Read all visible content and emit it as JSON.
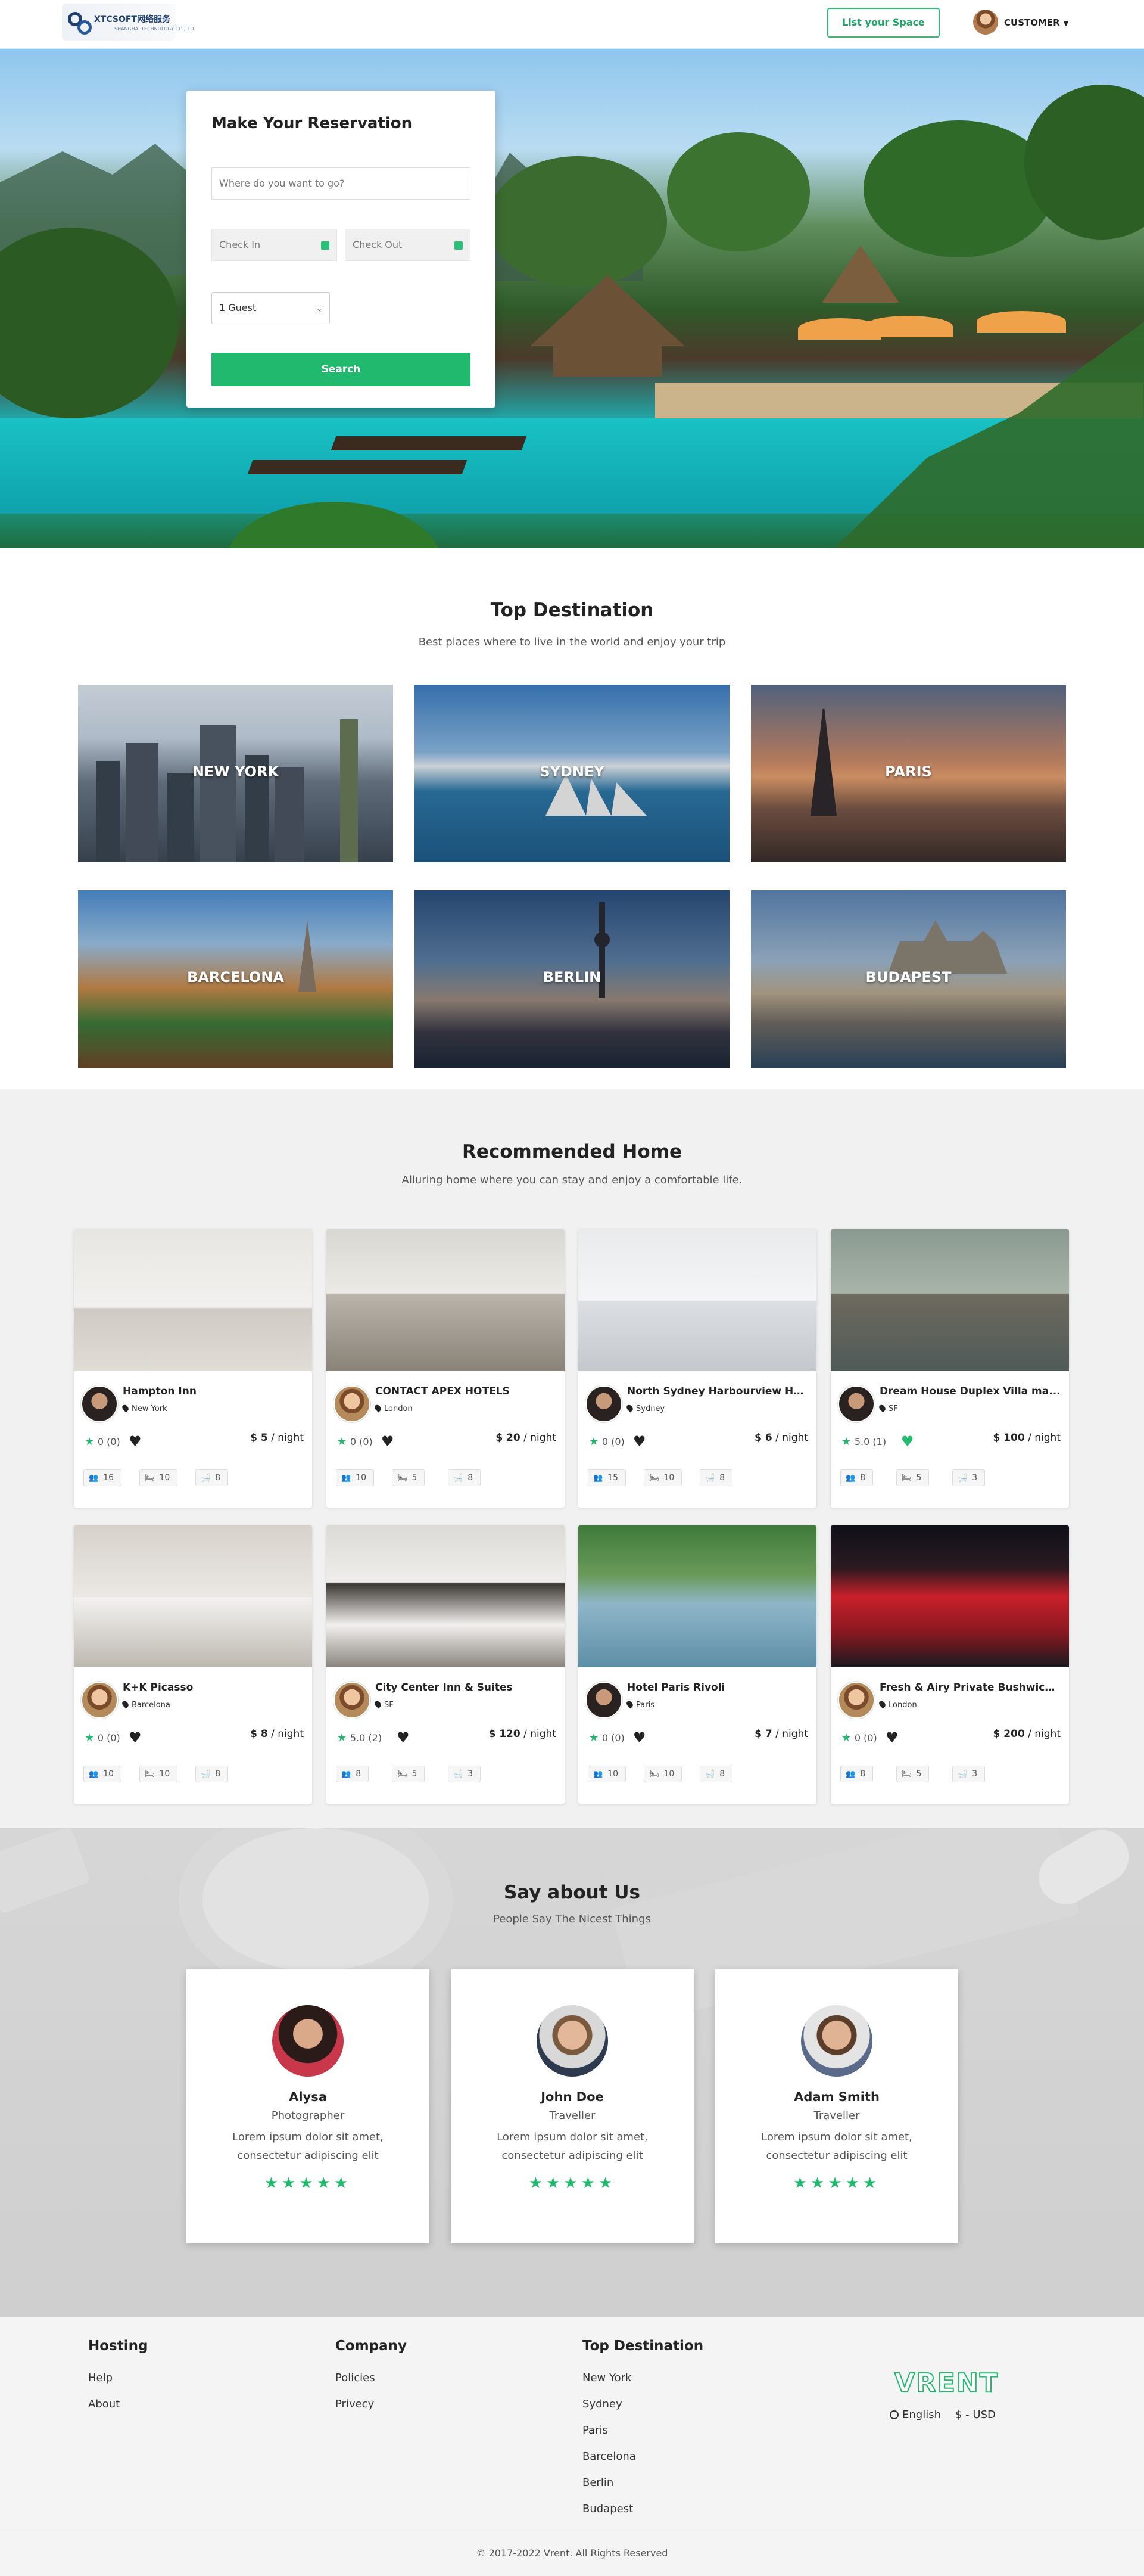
{
  "header": {
    "logo_text": "XTCSOFT网络服务",
    "logo_sub": "SHANGHAI TECHNOLOGY CO.,LTD",
    "list_space": "List your Space",
    "user_label": "CUSTOMER"
  },
  "reservation": {
    "title": "Make Your Reservation",
    "where_placeholder": "Where do you want to go?",
    "checkin_placeholder": "Check In",
    "checkout_placeholder": "Check Out",
    "guest_value": "1 Guest",
    "search_label": "Search"
  },
  "top_destination": {
    "title": "Top Destination",
    "subtitle": "Best places where to live in the world and enjoy your trip",
    "items": [
      {
        "label": "NEW YORK"
      },
      {
        "label": "SYDNEY"
      },
      {
        "label": "PARIS"
      },
      {
        "label": "BARCELONA"
      },
      {
        "label": "BERLIN"
      },
      {
        "label": "BUDAPEST"
      }
    ]
  },
  "recommended": {
    "title": "Recommended Home",
    "subtitle": "Alluring home where you can stay and enjoy a comfortable life.",
    "per_night": "/ night",
    "homes": [
      {
        "name": "Hampton Inn",
        "location": "New York",
        "rating": "0 (0)",
        "price": "$ 5",
        "guests": "16",
        "beds": "10",
        "baths": "8",
        "liked": false
      },
      {
        "name": "CONTACT APEX HOTELS",
        "location": "London",
        "rating": "0 (0)",
        "price": "$ 20",
        "guests": "10",
        "beds": "5",
        "baths": "8",
        "liked": false
      },
      {
        "name": "North Sydney Harbourview Ho...",
        "location": "Sydney",
        "rating": "0 (0)",
        "price": "$ 6",
        "guests": "15",
        "beds": "10",
        "baths": "8",
        "liked": false
      },
      {
        "name": "Dream House Duplex Villa ma...",
        "location": "SF",
        "rating": "5.0 (1)",
        "price": "$ 100",
        "guests": "8",
        "beds": "5",
        "baths": "3",
        "liked": true
      },
      {
        "name": "K+K Picasso",
        "location": "Barcelona",
        "rating": "0 (0)",
        "price": "$ 8",
        "guests": "10",
        "beds": "10",
        "baths": "8",
        "liked": false
      },
      {
        "name": "City Center Inn & Suites",
        "location": "SF",
        "rating": "5.0 (2)",
        "price": "$ 120",
        "guests": "8",
        "beds": "5",
        "baths": "3",
        "liked": false
      },
      {
        "name": "Hotel Paris Rivoli",
        "location": "Paris",
        "rating": "0 (0)",
        "price": "$ 7",
        "guests": "10",
        "beds": "10",
        "baths": "8",
        "liked": false
      },
      {
        "name": "Fresh & Airy Private Bushwick ...",
        "location": "London",
        "rating": "0 (0)",
        "price": "$ 200",
        "guests": "8",
        "beds": "5",
        "baths": "3",
        "liked": false
      }
    ]
  },
  "testimonials": {
    "title": "Say about Us",
    "subtitle": "People Say The Nicest Things",
    "items": [
      {
        "name": "Alysa",
        "role": "Photographer",
        "text": "Lorem ipsum dolor sit amet, consectetur adipiscing elit",
        "stars": "★★★★★"
      },
      {
        "name": "John Doe",
        "role": "Traveller",
        "text": "Lorem ipsum dolor sit amet, consectetur adipiscing elit",
        "stars": "★★★★★"
      },
      {
        "name": "Adam Smith",
        "role": "Traveller",
        "text": "Lorem ipsum dolor sit amet, consectetur adipiscing elit",
        "stars": "★★★★★"
      }
    ]
  },
  "footer": {
    "hosting": {
      "title": "Hosting",
      "links": [
        "Help",
        "About"
      ]
    },
    "company": {
      "title": "Company",
      "links": [
        "Policies",
        "Privecy"
      ]
    },
    "top_destination": {
      "title": "Top Destination",
      "links": [
        "New York",
        "Sydney",
        "Paris",
        "Barcelona",
        "Berlin",
        "Budapest"
      ]
    },
    "brand": "VRENT",
    "language": "English",
    "currency_symbol": "$ -",
    "currency_code": "USD",
    "copyright": "© 2017-2022 Vrent. All Rights Reserved"
  },
  "colors": {
    "accent": "#21b96d",
    "accent_border": "#28c178",
    "text": "#222222",
    "band_grey": "#f1f1f1"
  },
  "icons": {
    "calendar": "calendar-icon",
    "pin": "map-pin-icon",
    "star": "star-icon",
    "heart": "heart-icon",
    "guests": "users-icon",
    "bed": "bed-icon",
    "bath": "bath-icon",
    "globe": "globe-icon"
  }
}
